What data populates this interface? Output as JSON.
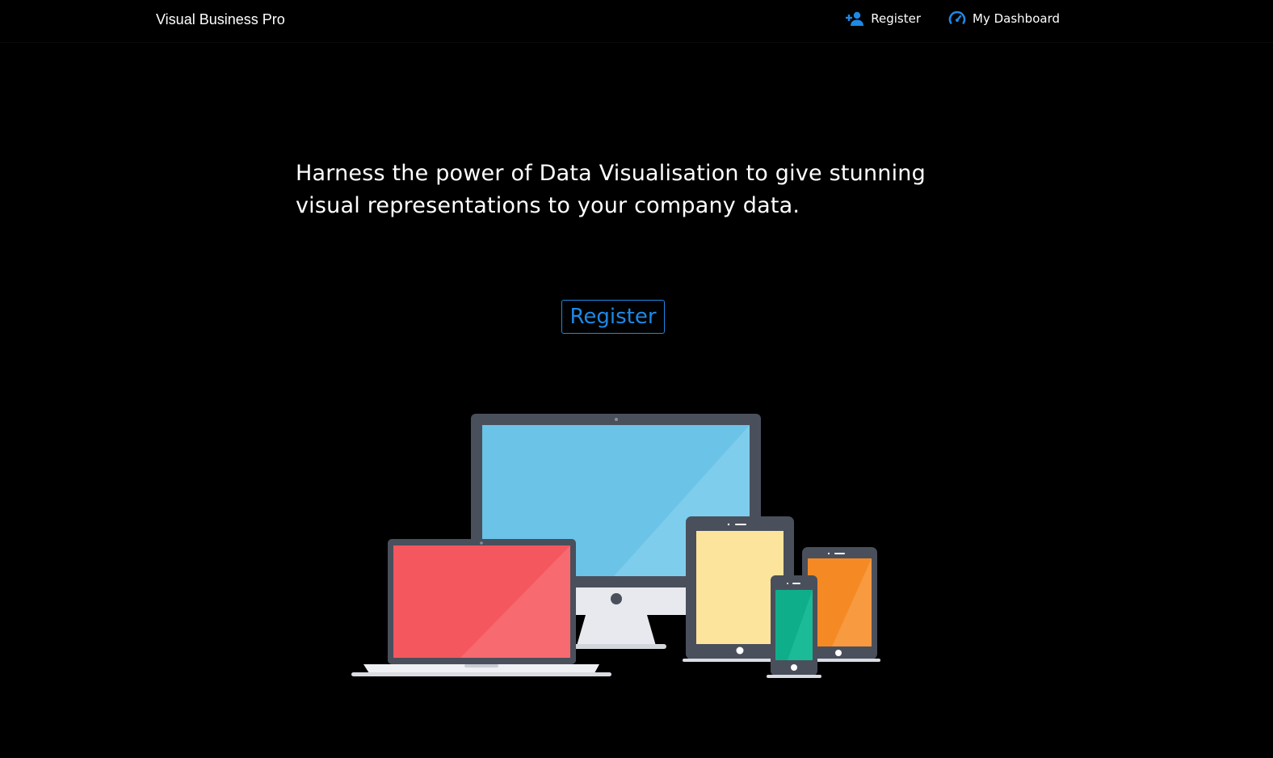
{
  "navbar": {
    "brand": "Visual Business Pro",
    "links": [
      {
        "label": "Register",
        "icon": "add-user-icon"
      },
      {
        "label": "My Dashboard",
        "icon": "speedometer-icon"
      }
    ]
  },
  "hero": {
    "headline": "Harness the power of Data Visualisation to give stunning visual representations to your company data.",
    "cta_label": "Register"
  },
  "colors": {
    "background": "#000000",
    "accent": "#1e88e5",
    "text": "#ffffff",
    "device_frame": "#4a4f5c",
    "monitor_screen": "#6bc3e8",
    "laptop_screen": "#f4575e",
    "tablet_screen": "#fde49c",
    "phone_screen": "#0fae8a",
    "small_tablet_screen": "#f58a25"
  },
  "illustration": {
    "icon": "devices-illustration"
  }
}
